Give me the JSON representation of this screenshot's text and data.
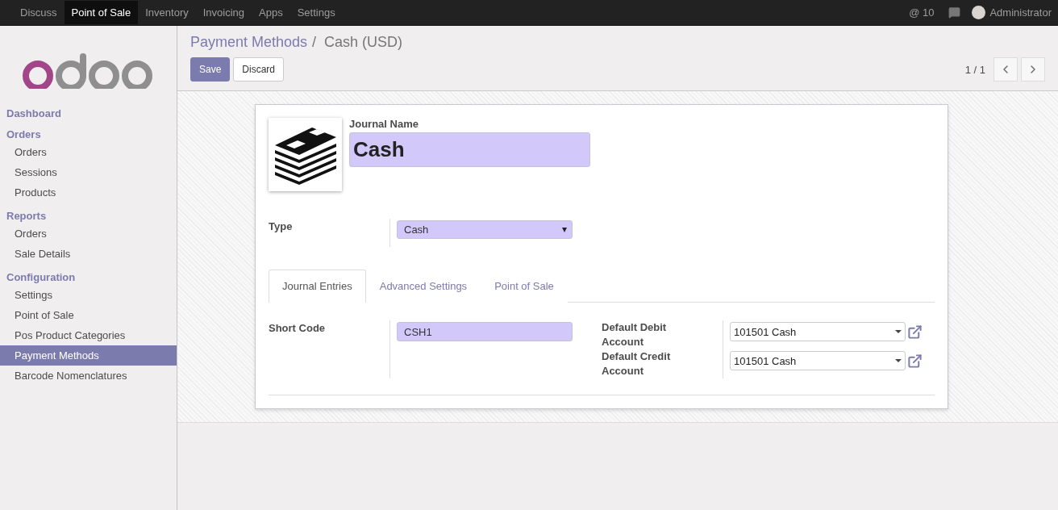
{
  "topbar": {
    "apps": [
      {
        "label": "Discuss",
        "selected": false
      },
      {
        "label": "Point of Sale",
        "selected": true
      },
      {
        "label": "Inventory",
        "selected": false
      },
      {
        "label": "Invoicing",
        "selected": false
      },
      {
        "label": "Apps",
        "selected": false
      },
      {
        "label": "Settings",
        "selected": false
      }
    ],
    "mentions": "@ 10",
    "user": "Administrator"
  },
  "sidebar": {
    "sections": [
      {
        "title": "Dashboard"
      },
      {
        "title": "Orders",
        "items": [
          {
            "label": "Orders",
            "selected": false
          },
          {
            "label": "Sessions",
            "selected": false
          },
          {
            "label": "Products",
            "selected": false
          }
        ]
      },
      {
        "title": "Reports",
        "items": [
          {
            "label": "Orders",
            "selected": false
          },
          {
            "label": "Sale Details",
            "selected": false
          }
        ]
      },
      {
        "title": "Configuration",
        "items": [
          {
            "label": "Settings",
            "selected": false
          },
          {
            "label": "Point of Sale",
            "selected": false
          },
          {
            "label": "Pos Product Categories",
            "selected": false
          },
          {
            "label": "Payment Methods",
            "selected": true
          },
          {
            "label": "Barcode Nomenclatures",
            "selected": false
          }
        ]
      }
    ]
  },
  "breadcrumb": {
    "parent": "Payment Methods",
    "separator": "/",
    "current": "Cash (USD)"
  },
  "buttons": {
    "save": "Save",
    "discard": "Discard"
  },
  "pager": "1 / 1",
  "form": {
    "name_label": "Journal Name",
    "name_value": "Cash",
    "type_label": "Type",
    "type_value": "Cash",
    "tabs": [
      {
        "label": "Journal Entries",
        "selected": true
      },
      {
        "label": "Advanced Settings",
        "selected": false
      },
      {
        "label": "Point of Sale",
        "selected": false
      }
    ],
    "short_code_label": "Short Code",
    "short_code_value": "CSH1",
    "accounts": [
      {
        "label": "Default Debit Account",
        "value": "101501 Cash"
      },
      {
        "label": "Default Credit Account",
        "value": "101501 Cash"
      }
    ]
  }
}
